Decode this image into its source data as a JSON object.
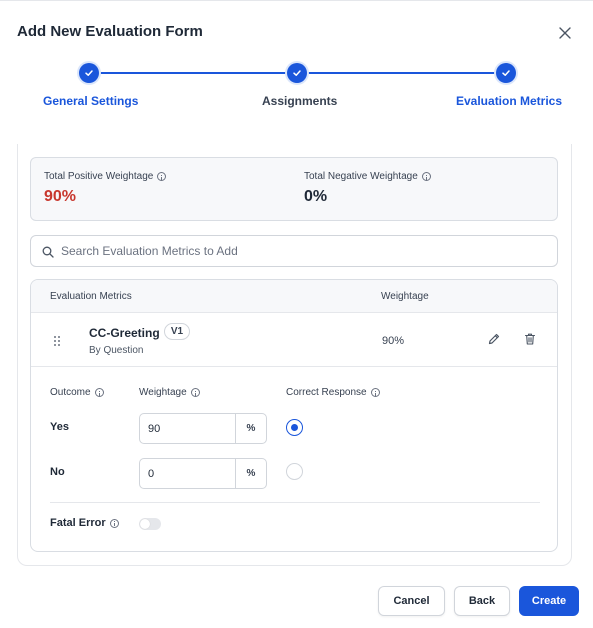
{
  "dialog": {
    "title": "Add New Evaluation Form",
    "close_icon": "close-icon"
  },
  "stepper": {
    "steps": [
      {
        "label": "General Settings",
        "status": "completed"
      },
      {
        "label": "Assignments",
        "status": "completed"
      },
      {
        "label": "Evaluation Metrics",
        "status": "current"
      }
    ]
  },
  "summary": {
    "positive_label": "Total Positive Weightage",
    "positive_value": "90%",
    "negative_label": "Total Negative Weightage",
    "negative_value": "0%"
  },
  "search": {
    "placeholder": "Search Evaluation Metrics to Add"
  },
  "table": {
    "headers": {
      "metric": "Evaluation Metrics",
      "weightage": "Weightage"
    },
    "row": {
      "name": "CC-Greeting",
      "version": "V1",
      "type": "By Question",
      "weightage": "90%"
    },
    "detail": {
      "outcome_label": "Outcome",
      "weightage_label": "Weightage",
      "correct_label": "Correct Response",
      "unit": "%",
      "options": [
        {
          "label": "Yes",
          "weightage": "90",
          "correct": true
        },
        {
          "label": "No",
          "weightage": "0",
          "correct": false
        }
      ],
      "fatal_error_label": "Fatal Error",
      "fatal_error_enabled": false
    }
  },
  "footer": {
    "cancel": "Cancel",
    "back": "Back",
    "create": "Create"
  },
  "colors": {
    "accent": "#1a56db",
    "positive_value": "#c8372d",
    "text": "#1f2937"
  }
}
